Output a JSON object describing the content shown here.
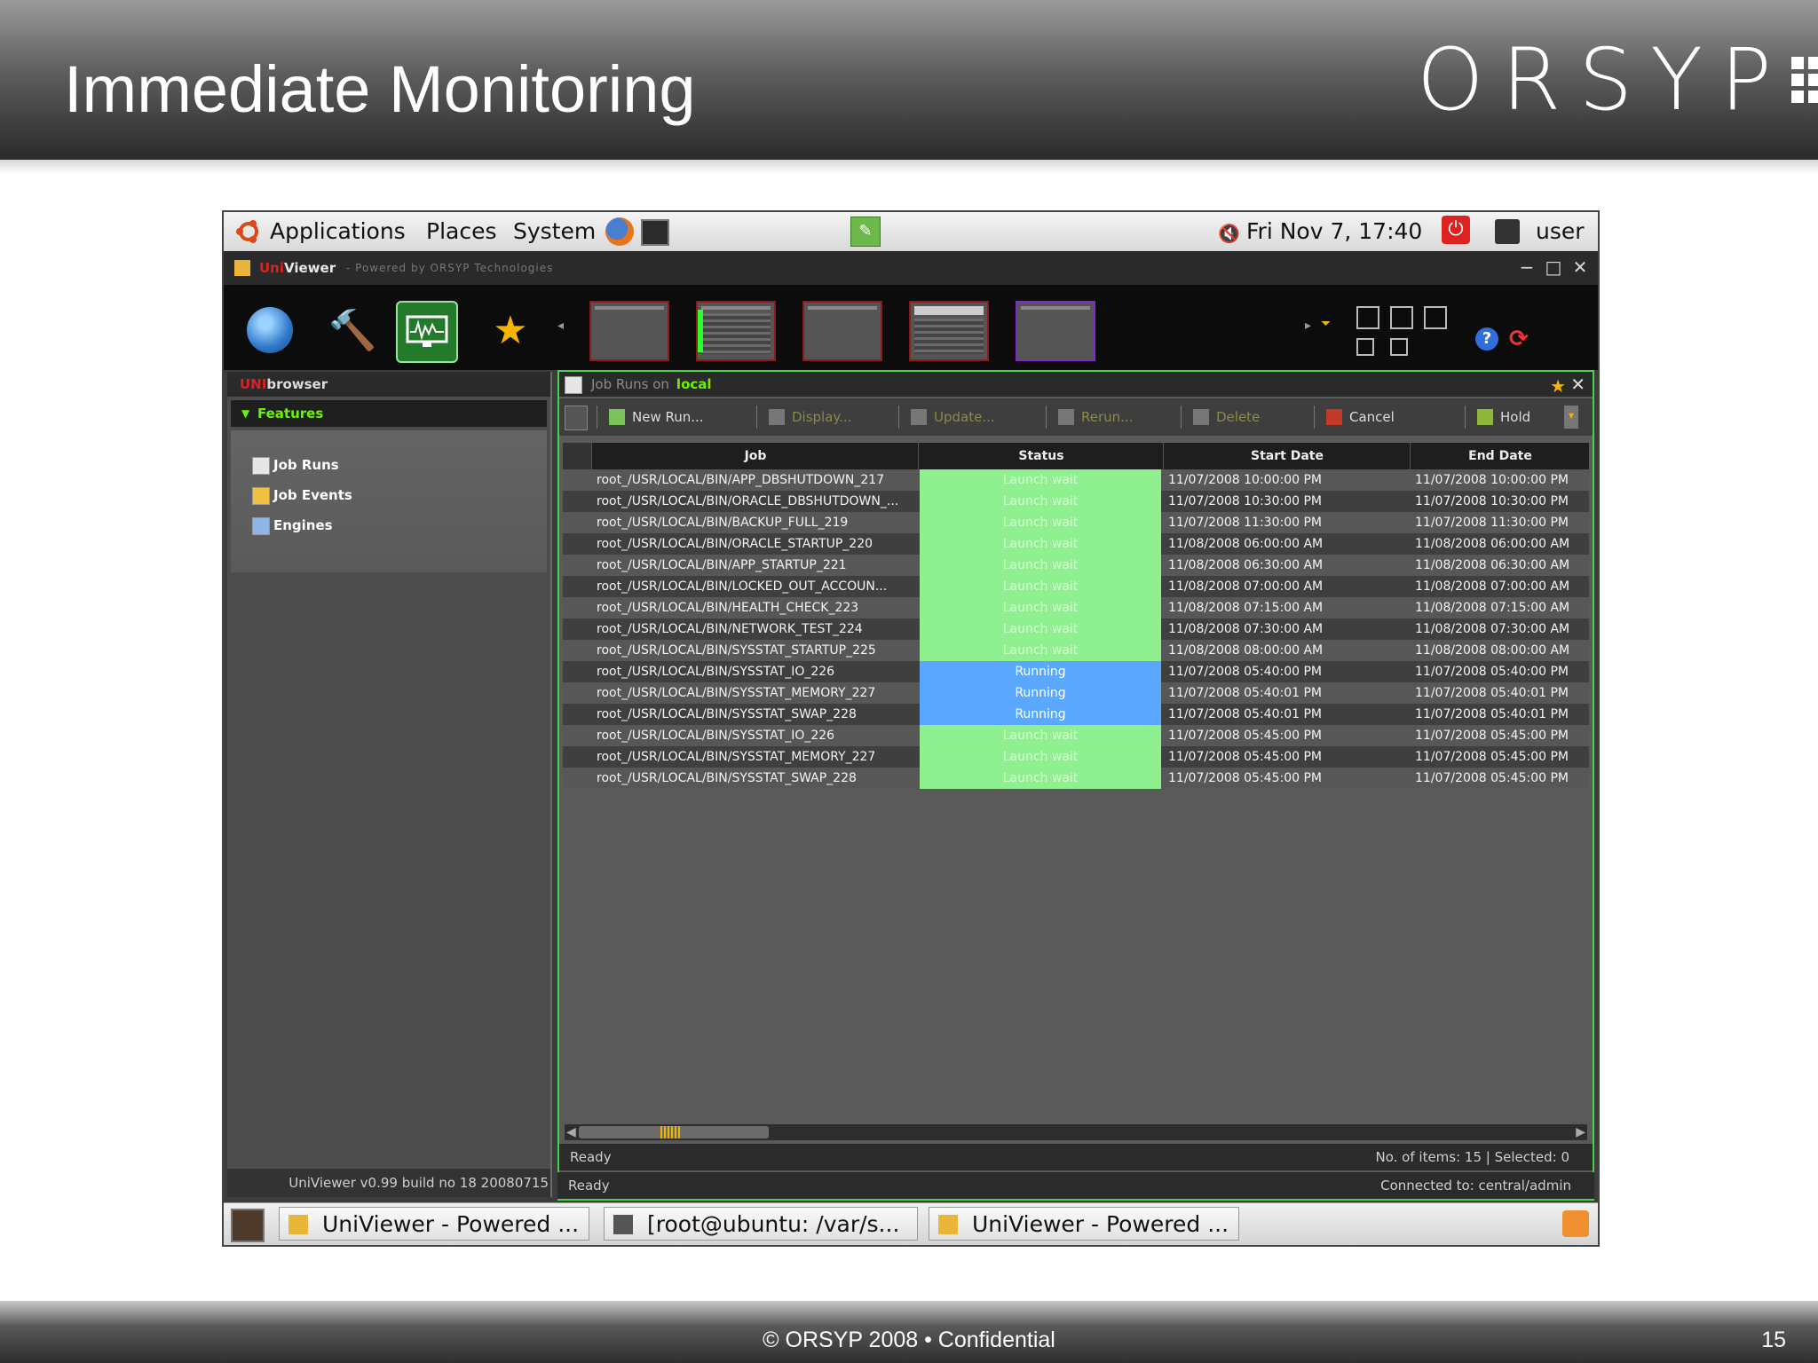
{
  "slide": {
    "title": "Immediate Monitoring",
    "logo_text": "ORSYP",
    "footer": "© ORSYP 2008 • Confidential",
    "page_number": "15"
  },
  "desktop": {
    "menu": [
      "Applications",
      "Places",
      "System"
    ],
    "clock": "Fri Nov  7, 17:40",
    "user": "user"
  },
  "app": {
    "title_uni": "Uni",
    "title_rest": "Viewer",
    "powered": "- Powered by ORSYP Technologies"
  },
  "browser": {
    "title_uni": "UNI",
    "title_rest": "browser",
    "features_label": "Features",
    "items": [
      "Job Runs",
      "Job Events",
      "Engines"
    ],
    "version": "UniViewer v0.99 build no 18 20080715"
  },
  "panel": {
    "title": "Job Runs on",
    "host": "local",
    "actions": [
      {
        "label": "New Run...",
        "enabled": true
      },
      {
        "label": "Display...",
        "enabled": false
      },
      {
        "label": "Update...",
        "enabled": false
      },
      {
        "label": "Rerun...",
        "enabled": false
      },
      {
        "label": "Delete",
        "enabled": false
      },
      {
        "label": "Cancel",
        "enabled": true
      },
      {
        "label": "Hold",
        "enabled": true
      }
    ],
    "columns": [
      "Job",
      "Status",
      "Start Date",
      "End Date"
    ],
    "rows": [
      {
        "job": "root_/USR/LOCAL/BIN/APP_DBSHUTDOWN_217",
        "status": "Launch wait",
        "start": "11/07/2008 10:00:00 PM",
        "end": "11/07/2008 10:00:00 PM"
      },
      {
        "job": "root_/USR/LOCAL/BIN/ORACLE_DBSHUTDOWN_...",
        "status": "Launch wait",
        "start": "11/07/2008 10:30:00 PM",
        "end": "11/07/2008 10:30:00 PM"
      },
      {
        "job": "root_/USR/LOCAL/BIN/BACKUP_FULL_219",
        "status": "Launch wait",
        "start": "11/07/2008 11:30:00 PM",
        "end": "11/07/2008 11:30:00 PM"
      },
      {
        "job": "root_/USR/LOCAL/BIN/ORACLE_STARTUP_220",
        "status": "Launch wait",
        "start": "11/08/2008 06:00:00 AM",
        "end": "11/08/2008 06:00:00 AM"
      },
      {
        "job": "root_/USR/LOCAL/BIN/APP_STARTUP_221",
        "status": "Launch wait",
        "start": "11/08/2008 06:30:00 AM",
        "end": "11/08/2008 06:30:00 AM"
      },
      {
        "job": "root_/USR/LOCAL/BIN/LOCKED_OUT_ACCOUN...",
        "status": "Launch wait",
        "start": "11/08/2008 07:00:00 AM",
        "end": "11/08/2008 07:00:00 AM"
      },
      {
        "job": "root_/USR/LOCAL/BIN/HEALTH_CHECK_223",
        "status": "Launch wait",
        "start": "11/08/2008 07:15:00 AM",
        "end": "11/08/2008 07:15:00 AM"
      },
      {
        "job": "root_/USR/LOCAL/BIN/NETWORK_TEST_224",
        "status": "Launch wait",
        "start": "11/08/2008 07:30:00 AM",
        "end": "11/08/2008 07:30:00 AM"
      },
      {
        "job": "root_/USR/LOCAL/BIN/SYSSTAT_STARTUP_225",
        "status": "Launch wait",
        "start": "11/08/2008 08:00:00 AM",
        "end": "11/08/2008 08:00:00 AM"
      },
      {
        "job": "root_/USR/LOCAL/BIN/SYSSTAT_IO_226",
        "status": "Running",
        "start": "11/07/2008 05:40:00 PM",
        "end": "11/07/2008 05:40:00 PM"
      },
      {
        "job": "root_/USR/LOCAL/BIN/SYSSTAT_MEMORY_227",
        "status": "Running",
        "start": "11/07/2008 05:40:01 PM",
        "end": "11/07/2008 05:40:01 PM"
      },
      {
        "job": "root_/USR/LOCAL/BIN/SYSSTAT_SWAP_228",
        "status": "Running",
        "start": "11/07/2008 05:40:01 PM",
        "end": "11/07/2008 05:40:01 PM"
      },
      {
        "job": "root_/USR/LOCAL/BIN/SYSSTAT_IO_226",
        "status": "Launch wait",
        "start": "11/07/2008 05:45:00 PM",
        "end": "11/07/2008 05:45:00 PM"
      },
      {
        "job": "root_/USR/LOCAL/BIN/SYSSTAT_MEMORY_227",
        "status": "Launch wait",
        "start": "11/07/2008 05:45:00 PM",
        "end": "11/07/2008 05:45:00 PM"
      },
      {
        "job": "root_/USR/LOCAL/BIN/SYSSTAT_SWAP_228",
        "status": "Launch wait",
        "start": "11/07/2008 05:45:00 PM",
        "end": "11/07/2008 05:45:00 PM"
      }
    ],
    "status_ready": "Ready",
    "items_info": "No. of items: 15 | Selected: 0",
    "connected": "Connected to: central/admin"
  },
  "taskbar": {
    "tasks": [
      "UniViewer - Powered ...",
      "[root@ubuntu: /var/s...",
      "UniViewer - Powered ..."
    ]
  },
  "colors": {
    "launch_wait": "#8ff08f",
    "running": "#5aa8ff",
    "accent_green": "#6cf200",
    "brand_red": "#e0262b"
  }
}
